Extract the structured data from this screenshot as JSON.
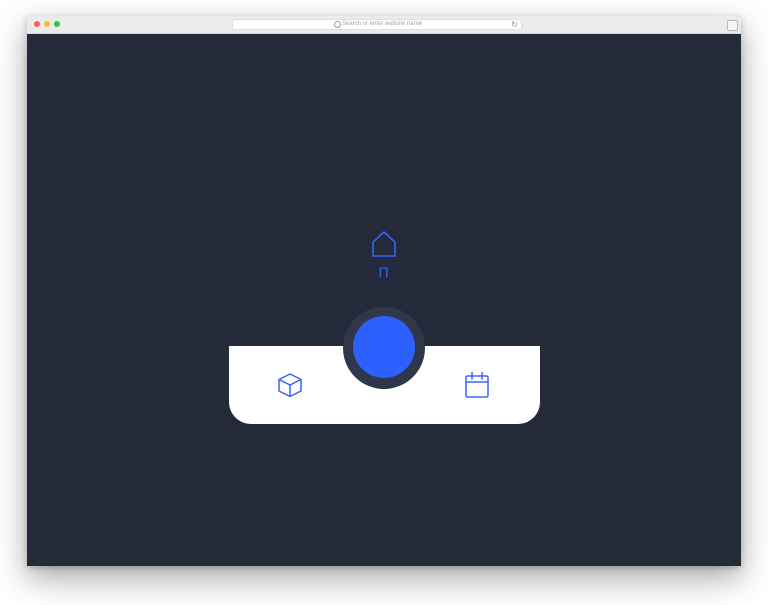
{
  "browser": {
    "address_placeholder": "Search or enter website name",
    "reload_icon": "reload-icon",
    "traffic_lights": [
      "close",
      "minimize",
      "maximize"
    ]
  },
  "page": {
    "background_color": "#252a3a",
    "accent_color": "#2d61ff",
    "active_item": {
      "icon": "home-icon",
      "label": "Π"
    },
    "nav_items": [
      {
        "icon": "box-icon"
      },
      {
        "icon": "home-icon",
        "active": true
      },
      {
        "icon": "calendar-icon"
      }
    ]
  }
}
